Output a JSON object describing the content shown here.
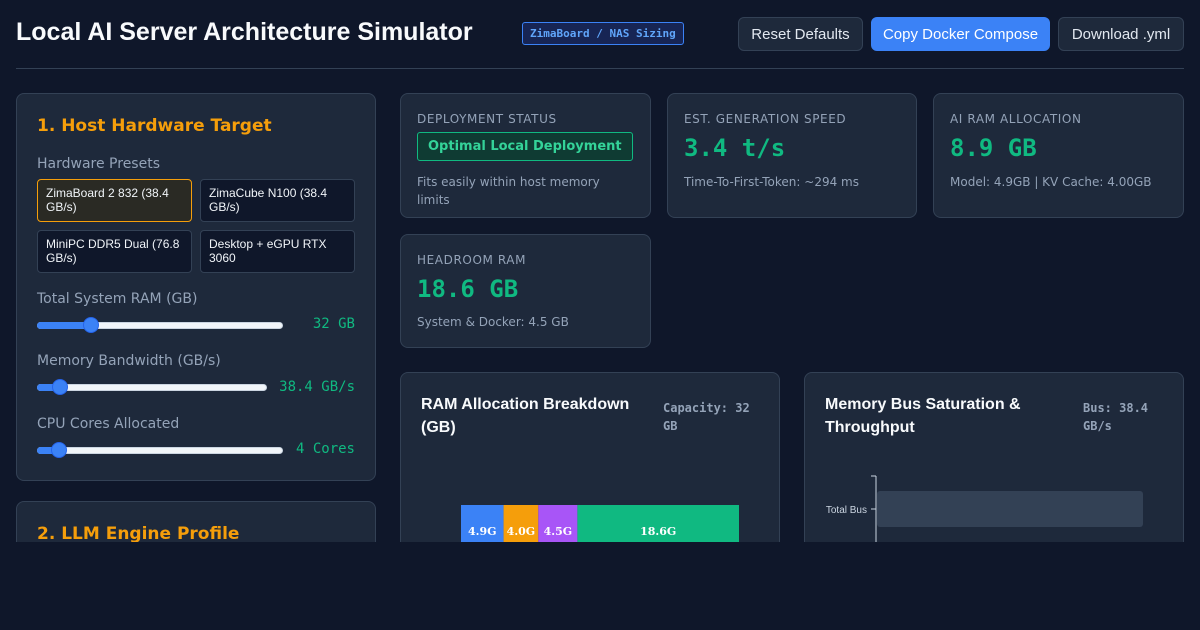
{
  "header": {
    "title": "Local AI Server Architecture Simulator",
    "badge": "ZimaBoard / NAS Sizing",
    "buttons": {
      "reset": "Reset Defaults",
      "copy": "Copy Docker Compose",
      "download": "Download .yml"
    }
  },
  "host_panel": {
    "title": "1. Host Hardware Target",
    "presets_label": "Hardware Presets",
    "presets": [
      {
        "label": "ZimaBoard 2 832 (38.4 GB/s)",
        "active": true
      },
      {
        "label": "ZimaCube N100 (38.4 GB/s)",
        "active": false
      },
      {
        "label": "MiniPC DDR5 Dual (76.8 GB/s)",
        "active": false
      },
      {
        "label": "Desktop + eGPU RTX 3060",
        "active": false
      }
    ],
    "sliders": [
      {
        "label": "Total System RAM (GB)",
        "value_text": "32 GB",
        "fraction": 0.22
      },
      {
        "label": "Memory Bandwidth (GB/s)",
        "value_text": "38.4 GB/s",
        "fraction": 0.1
      },
      {
        "label": "CPU Cores Allocated",
        "value_text": "4 Cores",
        "fraction": 0.09
      }
    ]
  },
  "llm_panel": {
    "title": "2. LLM Engine Profile"
  },
  "stats": {
    "status": {
      "label": "DEPLOYMENT STATUS",
      "badge": "Optimal Local Deployment",
      "sub": "Fits easily within host memory limits"
    },
    "speed": {
      "label": "EST. GENERATION SPEED",
      "value": "3.4 t/s",
      "sub": "Time-To-First-Token: ~294 ms"
    },
    "ram": {
      "label": "AI RAM ALLOCATION",
      "value": "8.9 GB",
      "sub": "Model: 4.9GB | KV Cache: 4.00GB"
    },
    "headroom": {
      "label": "HEADROOM RAM",
      "value": "18.6 GB",
      "sub": "System & Docker: 4.5 GB"
    }
  },
  "ram_chart": {
    "title": "RAM Allocation Breakdown (GB)",
    "caption": "Capacity: 32 GB"
  },
  "bus_chart": {
    "title": "Memory Bus Saturation & Throughput",
    "caption": "Bus: 38.4 GB/s"
  },
  "chart_data": [
    {
      "type": "bar",
      "stacked": true,
      "orientation": "horizontal",
      "total": 32,
      "series": [
        {
          "value": 4.9,
          "label": "4.9G",
          "color": "#3b82f6"
        },
        {
          "value": 4.0,
          "label": "4.0G",
          "color": "#f59e0b"
        },
        {
          "value": 4.5,
          "label": "4.5G",
          "color": "#a855f7"
        },
        {
          "value": 18.6,
          "label": "18.6G",
          "color": "#10b981"
        }
      ]
    },
    {
      "type": "bar",
      "orientation": "horizontal",
      "categories": [
        "Total Bus"
      ],
      "values": [
        38.4
      ],
      "xlim": [
        0,
        38.4
      ],
      "color": "#334155"
    }
  ]
}
